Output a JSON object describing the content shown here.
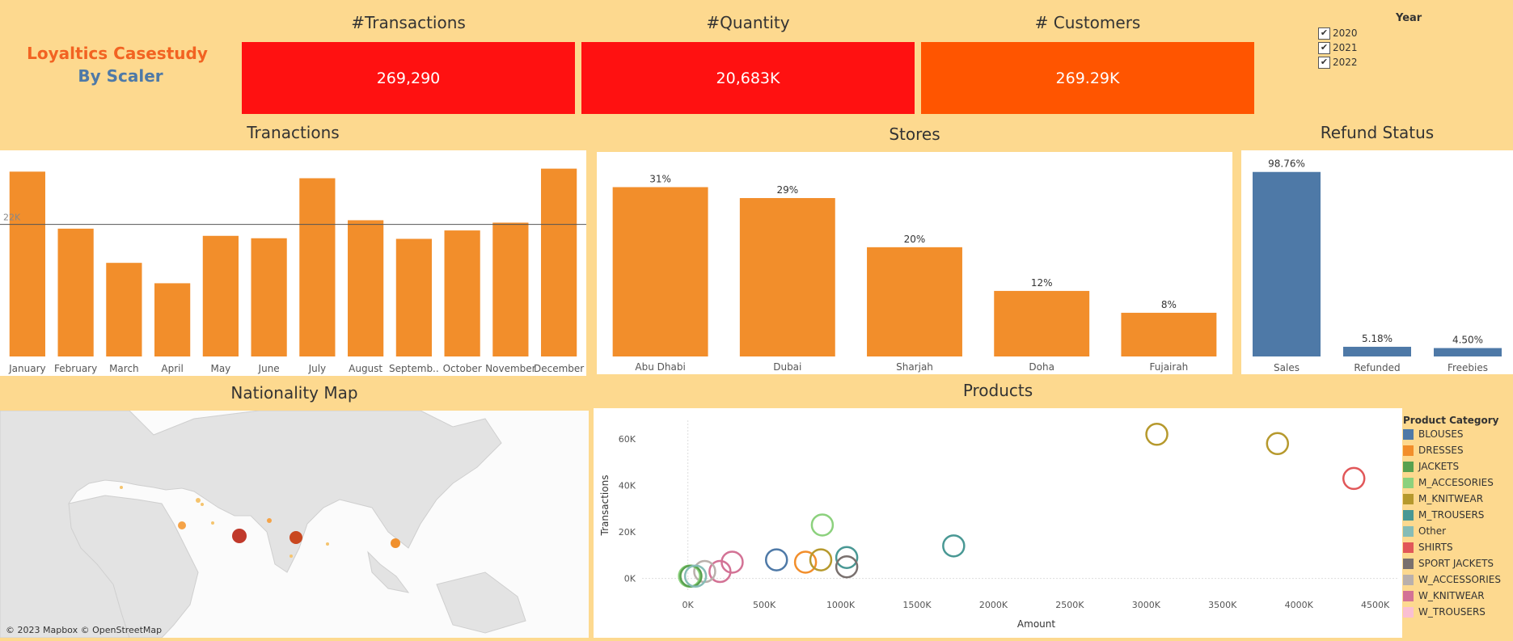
{
  "brand": {
    "line1": "Loyaltics Casestudy",
    "line2": "By Scaler"
  },
  "kpis": [
    {
      "title": "#Transactions",
      "value": "269,290",
      "color": "#ff1111"
    },
    {
      "title": "#Quantity",
      "value": "20,683K",
      "color": "#ff1111"
    },
    {
      "title": "# Customers",
      "value": "269.29K",
      "color": "#ff5500"
    }
  ],
  "year_filter": {
    "label": "Year",
    "options": [
      {
        "label": "2020",
        "checked": true
      },
      {
        "label": "2021",
        "checked": true
      },
      {
        "label": "2022",
        "checked": true
      }
    ]
  },
  "sections": {
    "transactions": "Tranactions",
    "stores": "Stores",
    "refund": "Refund Status",
    "map": "Nationality Map",
    "products": "Products"
  },
  "map": {
    "attribution": "© 2023 Mapbox © OpenStreetMap"
  },
  "chart_data": [
    {
      "type": "bar",
      "title": "Tranactions",
      "categories": [
        "January",
        "February",
        "March",
        "April",
        "May",
        "June",
        "July",
        "August",
        "Septemb..",
        "October",
        "November",
        "December"
      ],
      "values": [
        30800,
        21300,
        15600,
        12200,
        20100,
        19700,
        29700,
        22700,
        19600,
        21000,
        22300,
        31300
      ],
      "reference_line": {
        "value": 22000,
        "label": "22K"
      },
      "ylim": [
        0,
        33000
      ],
      "color": "#f28e2b"
    },
    {
      "type": "bar",
      "title": "Stores",
      "categories": [
        "Abu Dhabi",
        "Dubai",
        "Sharjah",
        "Doha",
        "Fujairah"
      ],
      "values": [
        31,
        29,
        20,
        12,
        8
      ],
      "labels": [
        "31%",
        "29%",
        "20%",
        "12%",
        "8%"
      ],
      "ylim": [
        0,
        33
      ],
      "color": "#f28e2b"
    },
    {
      "type": "bar",
      "title": "Refund Status",
      "categories": [
        "Sales",
        "Refunded",
        "Freebies"
      ],
      "values": [
        98.76,
        5.18,
        4.5
      ],
      "labels": [
        "98.76%",
        "5.18%",
        "4.50%"
      ],
      "ylim": [
        0,
        106
      ],
      "color": "#4e79a7",
      "small_color": "#4e79a7"
    },
    {
      "type": "scatter",
      "title": "Products",
      "xlabel": "Amount",
      "ylabel": "Transactions",
      "xticks": [
        "0K",
        "500K",
        "1000K",
        "1500K",
        "2000K",
        "2500K",
        "3000K",
        "3500K",
        "4000K",
        "4500K"
      ],
      "yticks": [
        "0K",
        "20K",
        "40K",
        "60K"
      ],
      "xlim": [
        -300,
        4650
      ],
      "ylim": [
        -5,
        68
      ],
      "legend_title": "Product Category",
      "legend": [
        {
          "name": "BLOUSES",
          "color": "#4e79a7"
        },
        {
          "name": "DRESSES",
          "color": "#f28e2b"
        },
        {
          "name": "JACKETS",
          "color": "#59a14f"
        },
        {
          "name": "M_ACCESORIES",
          "color": "#8cd17d"
        },
        {
          "name": "M_KNITWEAR",
          "color": "#b6992d"
        },
        {
          "name": "M_TROUSERS",
          "color": "#499894"
        },
        {
          "name": "Other",
          "color": "#86bcb6"
        },
        {
          "name": "SHIRTS",
          "color": "#e15759"
        },
        {
          "name": "SPORT JACKETS",
          "color": "#79706e"
        },
        {
          "name": "W_ACCESSORIES",
          "color": "#bab0ac"
        },
        {
          "name": "W_KNITWEAR",
          "color": "#d37295"
        },
        {
          "name": "W_TROUSERS",
          "color": "#fabfd2"
        }
      ],
      "points": [
        {
          "x": 3070,
          "y": 62,
          "series": "M_KNITWEAR"
        },
        {
          "x": 3860,
          "y": 58,
          "series": "M_KNITWEAR"
        },
        {
          "x": 4360,
          "y": 43,
          "series": "SHIRTS"
        },
        {
          "x": 880,
          "y": 23,
          "series": "M_ACCESORIES"
        },
        {
          "x": 1740,
          "y": 14,
          "series": "M_TROUSERS"
        },
        {
          "x": 580,
          "y": 8,
          "series": "BLOUSES"
        },
        {
          "x": 770,
          "y": 7,
          "series": "DRESSES"
        },
        {
          "x": 870,
          "y": 8,
          "series": "M_KNITWEAR"
        },
        {
          "x": 1040,
          "y": 9,
          "series": "M_TROUSERS"
        },
        {
          "x": 1040,
          "y": 5,
          "series": "SPORT JACKETS"
        },
        {
          "x": 290,
          "y": 7,
          "series": "W_KNITWEAR"
        },
        {
          "x": 210,
          "y": 3,
          "series": "W_KNITWEAR"
        },
        {
          "x": 110,
          "y": 3,
          "series": "W_ACCESSORIES"
        },
        {
          "x": 10,
          "y": 1,
          "series": "M_ACCESORIES"
        },
        {
          "x": 20,
          "y": 1,
          "series": "JACKETS"
        },
        {
          "x": 50,
          "y": 1,
          "series": "Other"
        }
      ]
    }
  ]
}
